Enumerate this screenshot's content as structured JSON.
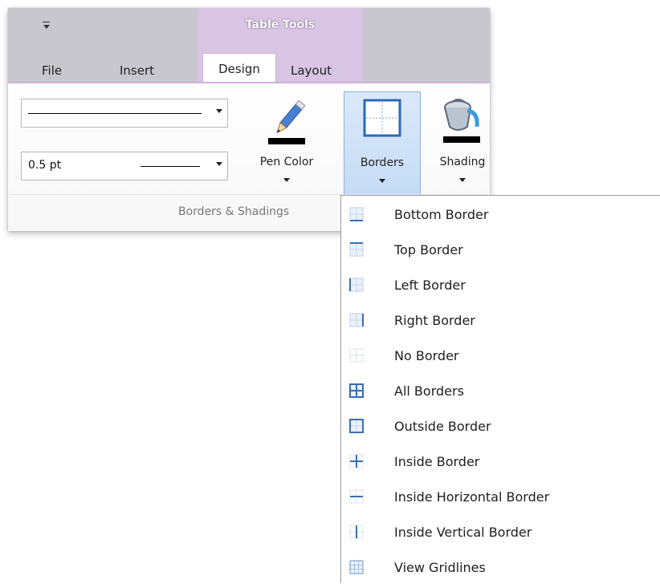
{
  "quick_access": {
    "icon": "customize-quick-access-arrow"
  },
  "context": {
    "title": "Table Tools"
  },
  "tabs": [
    {
      "label": "File"
    },
    {
      "label": "Insert"
    },
    {
      "label": "Design",
      "active": true
    },
    {
      "label": "Layout"
    }
  ],
  "group": {
    "label": "Borders & Shadings",
    "line_style_combo": {
      "value": ""
    },
    "line_weight_combo": {
      "value": "0.5 pt"
    },
    "pen_color": {
      "label": "Pen Color",
      "icon": "pencil-icon",
      "color": "#000000"
    },
    "borders": {
      "label": "Borders",
      "icon": "borders-icon"
    },
    "shading": {
      "label": "Shading",
      "icon": "paint-bucket-icon",
      "color": "#000000"
    }
  },
  "menu": {
    "items": [
      {
        "label": "Bottom Border",
        "icon": "bottom-border-icon"
      },
      {
        "label": "Top Border",
        "icon": "top-border-icon"
      },
      {
        "label": "Left Border",
        "icon": "left-border-icon"
      },
      {
        "label": "Right Border",
        "icon": "right-border-icon"
      },
      {
        "label": "No Border",
        "icon": "no-border-icon"
      },
      {
        "label": "All Borders",
        "icon": "all-borders-icon"
      },
      {
        "label": "Outside Border",
        "icon": "outside-border-icon"
      },
      {
        "label": "Inside Border",
        "icon": "inside-border-icon"
      },
      {
        "label": "Inside Horizontal Border",
        "icon": "inside-horizontal-border-icon"
      },
      {
        "label": "Inside Vertical Border",
        "icon": "inside-vertical-border-icon"
      },
      {
        "label": "View Gridlines",
        "icon": "view-gridlines-icon"
      }
    ]
  },
  "colors": {
    "accent": "#cdb3de",
    "selected_button": "#c5dbf5",
    "border_blue": "#3a6fb0"
  }
}
